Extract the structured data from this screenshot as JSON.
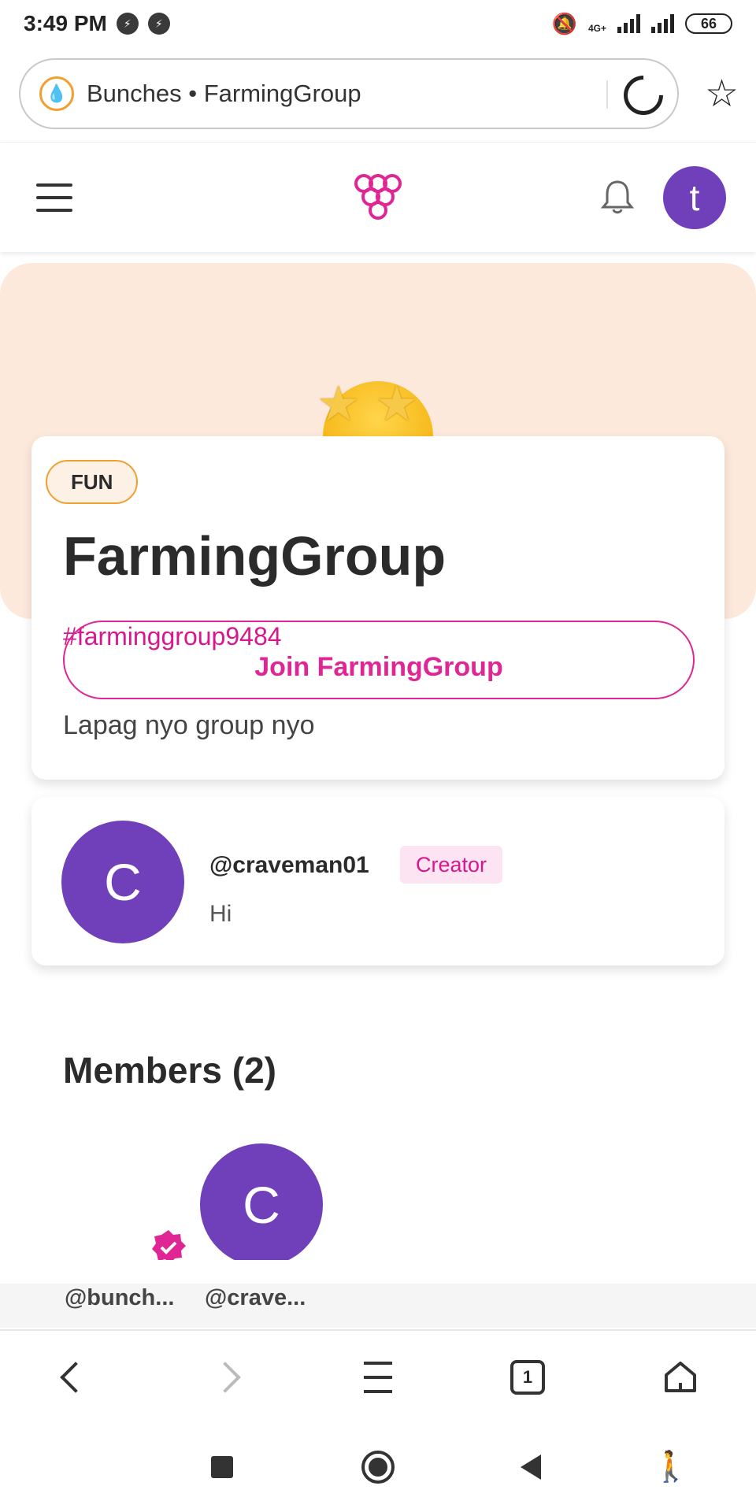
{
  "status_bar": {
    "time": "3:49 PM",
    "network": "4G+",
    "battery": "66"
  },
  "browser": {
    "address_text": "Bunches • FarmingGroup",
    "tab_count": "1"
  },
  "group": {
    "category": "FUN",
    "name": "FarmingGroup",
    "hashtag": "#farminggroup9484",
    "join_label": "Join FarmingGroup",
    "description": "Lapag nyo group nyo"
  },
  "header": {
    "user_initial": "t"
  },
  "creator": {
    "initial": "C",
    "handle": "@craveman01",
    "badge": "Creator",
    "message": "Hi"
  },
  "members": {
    "title": "Members (2)",
    "list": [
      {
        "handle": "@bunch..."
      },
      {
        "handle": "@crave...",
        "initial": "C"
      }
    ]
  },
  "colors": {
    "brand": "#e02594",
    "avatar": "#7040bb",
    "hero_bg": "#fde9dc",
    "fun_border": "#f0a030"
  },
  "icons": {
    "site": "droplet-icon",
    "logo": "grape-bunch-icon",
    "notification": "bell-icon",
    "verified": "verified-badge-icon"
  }
}
